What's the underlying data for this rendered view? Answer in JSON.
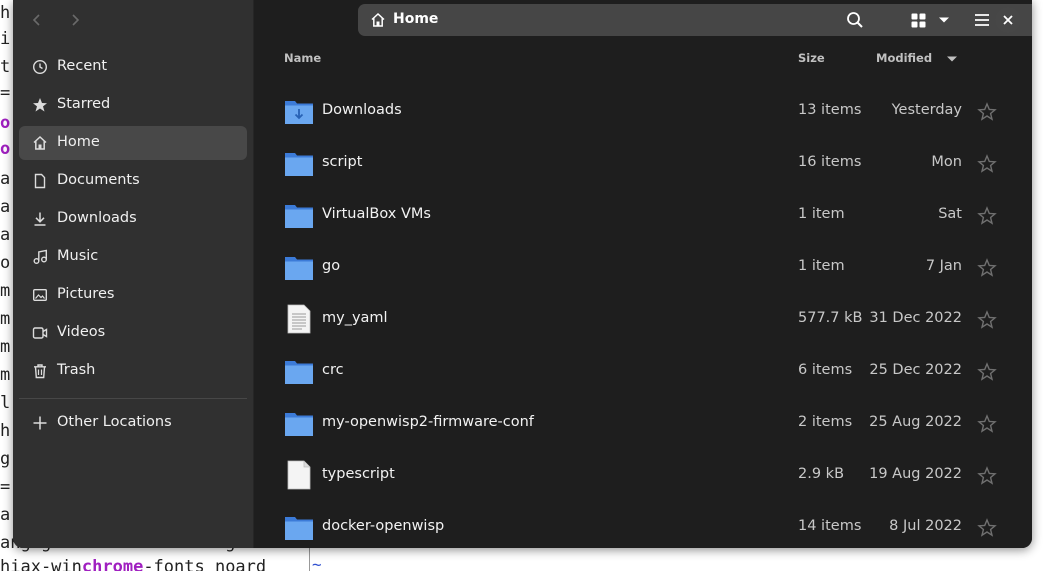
{
  "colors": {
    "window_bg": "#1e1e1e",
    "sidebar_bg": "#303030",
    "folder_blue": "#5294e2",
    "active_item": "#484848"
  },
  "background_terminal": {
    "lines": [
      "h",
      "i",
      "t",
      "=",
      "o",
      "o",
      "a",
      "a",
      "a",
      "o",
      "m",
      "m",
      "m",
      "m",
      "l",
      "h",
      "g",
      "=",
      "a"
    ],
    "bottom_lines": [
      {
        "pre": "ang github monochrome gc ",
        "hl": ""
      },
      {
        "pre": "hiax-win",
        "hl": "chrome",
        "post": "-fonts noard"
      }
    ],
    "tilde": "~"
  },
  "header": {
    "back_icon": "chevron-left-icon",
    "forward_icon": "chevron-right-icon",
    "path_icon": "home-icon",
    "path_label": "Home",
    "path_menu_icon": "kebab-menu-icon",
    "search_icon": "search-icon",
    "view_icon": "grid-view-icon",
    "view_dropdown_icon": "caret-down-icon",
    "menu_icon": "hamburger-menu-icon",
    "close_icon": "close-icon"
  },
  "sidebar": {
    "items": [
      {
        "label": "Recent",
        "icon": "clock-icon",
        "active": false
      },
      {
        "label": "Starred",
        "icon": "star-icon",
        "active": false
      },
      {
        "label": "Home",
        "icon": "home-icon",
        "active": true
      },
      {
        "label": "Documents",
        "icon": "document-icon",
        "active": false
      },
      {
        "label": "Downloads",
        "icon": "download-icon",
        "active": false
      },
      {
        "label": "Music",
        "icon": "music-icon",
        "active": false
      },
      {
        "label": "Pictures",
        "icon": "picture-icon",
        "active": false
      },
      {
        "label": "Videos",
        "icon": "video-icon",
        "active": false
      },
      {
        "label": "Trash",
        "icon": "trash-icon",
        "active": false
      }
    ],
    "other_locations": {
      "label": "Other Locations",
      "icon": "plus-icon"
    }
  },
  "columns": {
    "name": "Name",
    "size": "Size",
    "modified": "Modified",
    "sort_icon": "sort-down-icon"
  },
  "files": [
    {
      "name": "Downloads",
      "size": "13 items",
      "modified": "Yesterday",
      "type": "folder-download"
    },
    {
      "name": "script",
      "size": "16 items",
      "modified": "Mon",
      "type": "folder"
    },
    {
      "name": "VirtualBox VMs",
      "size": "1 item",
      "modified": "Sat",
      "type": "folder"
    },
    {
      "name": "go",
      "size": "1 item",
      "modified": "7 Jan",
      "type": "folder"
    },
    {
      "name": "my_yaml",
      "size": "577.7 kB",
      "modified": "31 Dec 2022",
      "type": "text"
    },
    {
      "name": "crc",
      "size": "6 items",
      "modified": "25 Dec 2022",
      "type": "folder"
    },
    {
      "name": "my-openwisp2-firmware-conf",
      "size": "2 items",
      "modified": "25 Aug 2022",
      "type": "folder"
    },
    {
      "name": "typescript",
      "size": "2.9 kB",
      "modified": "19 Aug 2022",
      "type": "blank"
    },
    {
      "name": "docker-openwisp",
      "size": "14 items",
      "modified": "8 Jul 2022",
      "type": "folder"
    }
  ]
}
